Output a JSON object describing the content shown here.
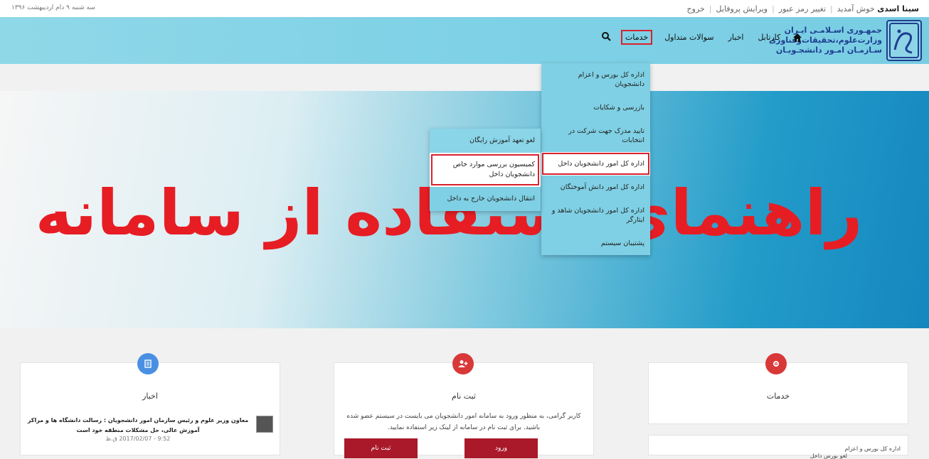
{
  "topbar": {
    "date": "سه شنبه ۹ دام اردیبهشت ۱۳۹۶",
    "welcome_name": "سینا اسدی",
    "welcome_suffix": "خوش آمدید",
    "change_password": "تغییر رمز عبور",
    "edit_profile": "ویرایش پروفایل",
    "logout": "خروج"
  },
  "logo": {
    "line1": "جمهـوری اسـلامـی ایـران",
    "line2": "وزارت‌علوم،تحقیقات‌وفناوری",
    "line3": "سـازمـان امـور دانشجـویـان"
  },
  "menu": {
    "home_icon": "home-icon",
    "items": [
      "کارتابل",
      "اخبار",
      "سوالات متداول",
      "خدمات"
    ],
    "search_icon": "search-icon"
  },
  "dropdown": [
    "اداره کل بورس و اعزام دانشجویان",
    "بازرسی و شکایات",
    "تایید مدرک جهت شرکت در انتخابات",
    "اداره کل امور دانشجویان داخل",
    "اداره کل امور دانش آموختگان",
    "اداره کل امور دانشجویان شاهد و ایثارگر",
    "پشتیبان سیستم"
  ],
  "submenu": [
    "لغو تعهد آموزش رایگان",
    "کمیسیون بررسی موارد خاص دانشجویان داخل",
    "انتقال دانشجویان خارج به داخل"
  ],
  "hero": {
    "title": "راهنمای استفاده از سامانه"
  },
  "cards": {
    "services": {
      "title": "خدمات",
      "icon": "gear-icon",
      "list_head": "اداره کل بورس و اعزام",
      "list_item": "لغو بورس داخل"
    },
    "register": {
      "title": "ثبت نام",
      "icon": "add-user-icon",
      "text": "کاربر گرامی، به منظور ورود به سامانه امور دانشجویان می بایست در سیستم عضو شده باشید. برای ثبت نام در سامانه از لینک زیر استفاده نمایید.",
      "login_button": "ورود",
      "register_button": "ثبت نام"
    },
    "news": {
      "title": "اخبار",
      "icon": "newspaper-icon",
      "headline": "معاون وزیر علوم و رئیس سازمان امور دانشجویان : رسالت دانشگاه ها و مراکز آموزش عالی، حل مشکلات منطقه خود است",
      "time": "9:52 - 2017/02/07 ق.ظ"
    }
  },
  "colors": {
    "accent_red": "#e71d24",
    "button_red": "#a9192a",
    "nav_blue": "#7fd1e6",
    "icon_blue": "#4a90e2",
    "icon_red": "#d93838"
  }
}
